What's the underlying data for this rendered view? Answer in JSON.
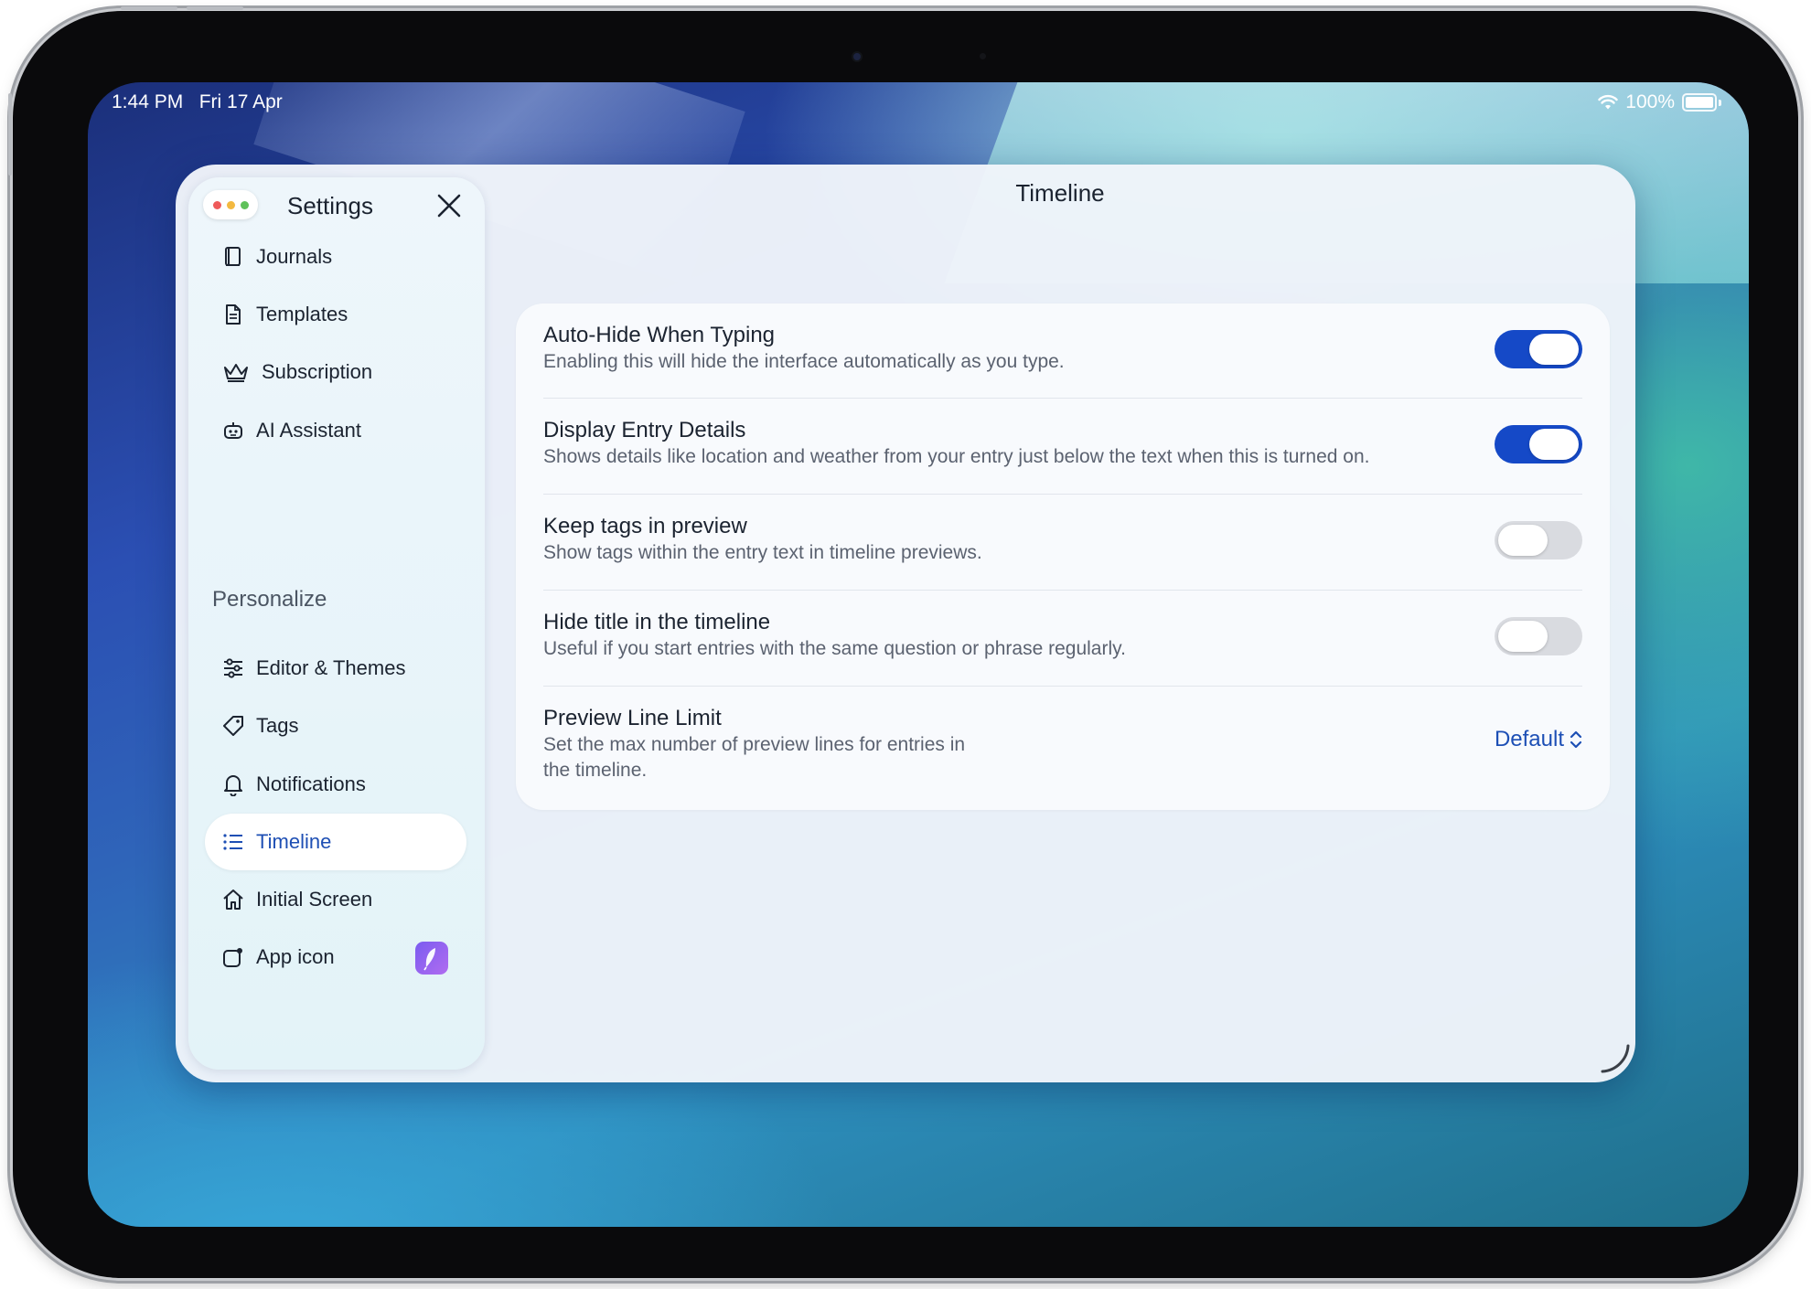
{
  "status_bar": {
    "time": "1:44 PM",
    "date": "Fri 17 Apr",
    "battery": "100%",
    "wifi_icon": "wifi-icon"
  },
  "sidebar": {
    "title": "Settings",
    "section_label": "Personalize",
    "items": [
      {
        "label": "Journals",
        "icon": "book-icon"
      },
      {
        "label": "Templates",
        "icon": "document-icon"
      },
      {
        "label": "Subscription",
        "icon": "crown-icon"
      },
      {
        "label": "AI Assistant",
        "icon": "robot-icon"
      },
      {
        "label": "Editor & Themes",
        "icon": "sliders-icon"
      },
      {
        "label": "Tags",
        "icon": "tag-icon"
      },
      {
        "label": "Notifications",
        "icon": "bell-icon"
      },
      {
        "label": "Timeline",
        "icon": "list-icon",
        "active": true
      },
      {
        "label": "Initial Screen",
        "icon": "home-icon"
      },
      {
        "label": "App icon",
        "icon": "app-icon"
      }
    ]
  },
  "main": {
    "title": "Timeline",
    "settings": [
      {
        "title": "Auto-Hide When Typing",
        "description": "Enabling this will hide the interface automatically as you type.",
        "enabled": true
      },
      {
        "title": "Display Entry Details",
        "description": "Shows details like location and weather from your entry just below the text when this is turned on.",
        "enabled": true
      },
      {
        "title": "Keep tags in preview",
        "description": "Show tags within the entry text in timeline previews.",
        "enabled": false
      },
      {
        "title": "Hide title in the timeline",
        "description": "Useful if you start entries with the same question or phrase regularly.",
        "enabled": false
      },
      {
        "title": "Preview Line Limit",
        "description_line1": "Set the max number of preview lines for entries in",
        "description_line2": "the timeline.",
        "value": "Default"
      }
    ]
  },
  "colors": {
    "accent": "#1549c7",
    "link": "#1d4fb5"
  }
}
